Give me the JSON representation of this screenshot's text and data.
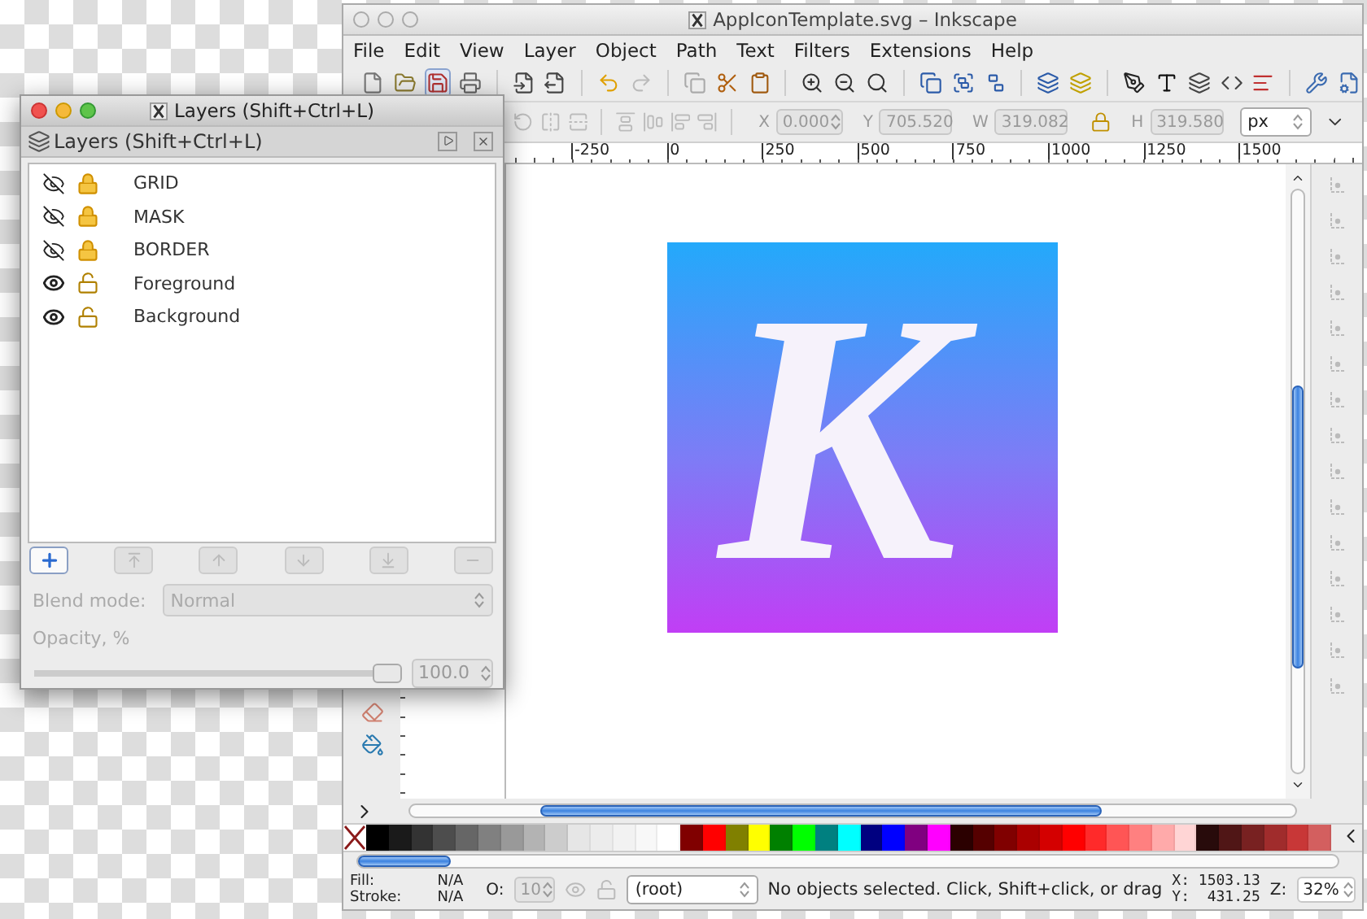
{
  "window": {
    "title": "AppIconTemplate.svg – Inkscape"
  },
  "menu": [
    "File",
    "Edit",
    "View",
    "Layer",
    "Object",
    "Path",
    "Text",
    "Filters",
    "Extensions",
    "Help"
  ],
  "controls": [
    {
      "label": "X",
      "value": "0.000"
    },
    {
      "label": "Y",
      "value": "705.520"
    },
    {
      "label": "W",
      "value": "319.082"
    },
    {
      "label": "H",
      "value": "319.580"
    }
  ],
  "unit": "px",
  "ruler": [
    "-250",
    "0",
    "250",
    "500",
    "750",
    "1000",
    "1250",
    "1500"
  ],
  "artwork": {
    "letter": "K"
  },
  "palette": [
    {
      "color": "#000000"
    },
    {
      "color": "#1a1a1a"
    },
    {
      "color": "#333333"
    },
    {
      "color": "#4d4d4d"
    },
    {
      "color": "#666666"
    },
    {
      "color": "#808080"
    },
    {
      "color": "#999999"
    },
    {
      "color": "#b3b3b3"
    },
    {
      "color": "#cccccc"
    },
    {
      "color": "#e6e6e6"
    },
    {
      "color": "#ececec"
    },
    {
      "color": "#f2f2f2"
    },
    {
      "color": "#f8f8f8"
    },
    {
      "color": "#ffffff"
    },
    {
      "color": "#800000"
    },
    {
      "color": "#ff0000"
    },
    {
      "color": "#808000"
    },
    {
      "color": "#ffff00"
    },
    {
      "color": "#008000"
    },
    {
      "color": "#00ff00"
    },
    {
      "color": "#008080"
    },
    {
      "color": "#00ffff"
    },
    {
      "color": "#000080"
    },
    {
      "color": "#0000ff"
    },
    {
      "color": "#800080"
    },
    {
      "color": "#ff00ff"
    },
    {
      "color": "#2b0000"
    },
    {
      "color": "#550000"
    },
    {
      "color": "#800000"
    },
    {
      "color": "#aa0000"
    },
    {
      "color": "#d40000"
    },
    {
      "color": "#ff0000"
    },
    {
      "color": "#ff2a2a"
    },
    {
      "color": "#ff5555"
    },
    {
      "color": "#ff8080"
    },
    {
      "color": "#ffaaaa"
    },
    {
      "color": "#ffd5d5"
    },
    {
      "color": "#280b0b"
    },
    {
      "color": "#501616"
    },
    {
      "color": "#782121"
    },
    {
      "color": "#a02c2c"
    },
    {
      "color": "#c83737"
    },
    {
      "color": "#d35f5f"
    }
  ],
  "status": {
    "fill_label": "Fill:",
    "fill": "N/A",
    "stroke_label": "Stroke:",
    "stroke": "N/A",
    "opacity_label": "O:",
    "opacity": "10",
    "layer": "(root)",
    "message": "No objects selected. Click, Shift+click, or drag",
    "x": "X: 1503.13",
    "y": "Y:  431.25",
    "zoom_label": "Z:",
    "zoom": "32%"
  },
  "layers_dialog": {
    "title": "Layers (Shift+Ctrl+L)",
    "panel_title": "Layers (Shift+Ctrl+L)",
    "layers": [
      {
        "name": "GRID",
        "visible": false,
        "locked": true
      },
      {
        "name": "MASK",
        "visible": false,
        "locked": true
      },
      {
        "name": "BORDER",
        "visible": false,
        "locked": true
      },
      {
        "name": "Foreground",
        "visible": true,
        "locked": false
      },
      {
        "name": "Background",
        "visible": true,
        "locked": false
      }
    ],
    "blend_label": "Blend mode:",
    "blend": "Normal",
    "opacity_label": "Opacity, %",
    "opacity_slider": {
      "level": 1
    },
    "opacity": "100.0"
  }
}
